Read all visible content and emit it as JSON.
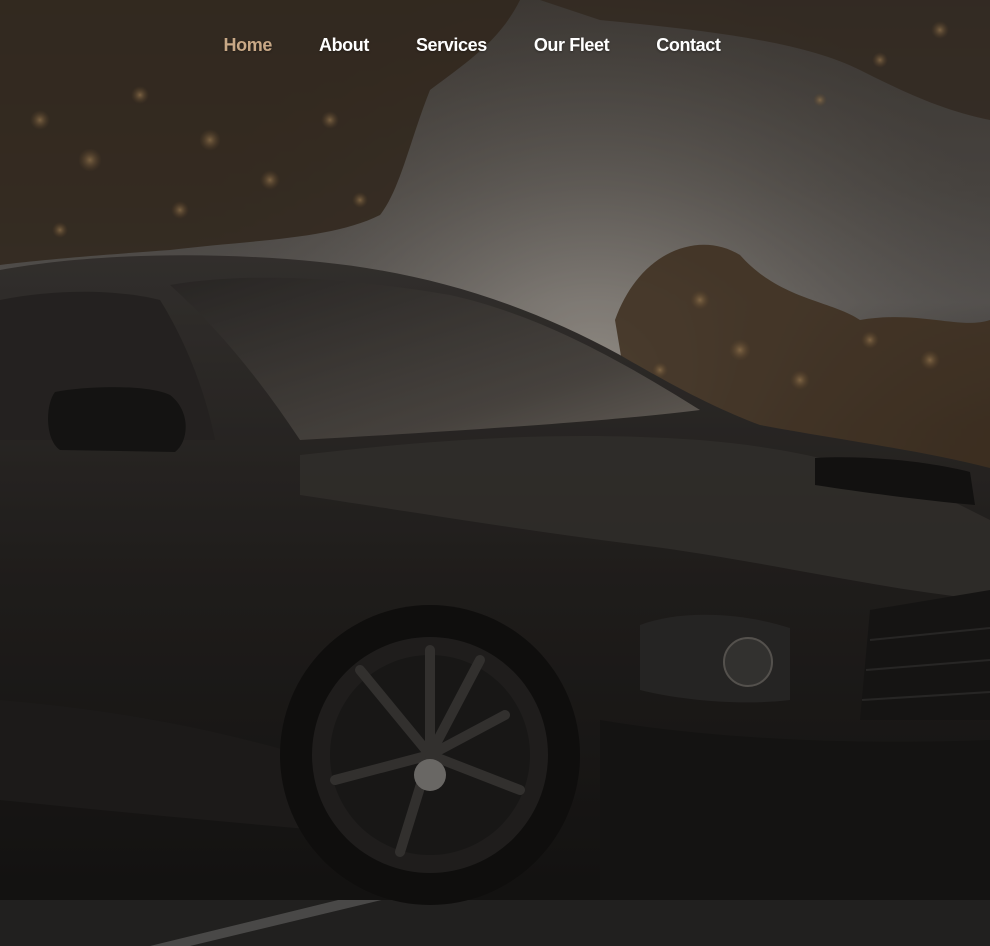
{
  "nav": {
    "items": [
      {
        "label": "Home",
        "active": true
      },
      {
        "label": "About",
        "active": false
      },
      {
        "label": "Services",
        "active": false
      },
      {
        "label": "Our Fleet",
        "active": false
      },
      {
        "label": "Contact",
        "active": false
      }
    ],
    "active_color": "#c8a886",
    "text_color": "#ffffff"
  },
  "hero": {
    "image_subject": "black-sports-car-photo"
  }
}
